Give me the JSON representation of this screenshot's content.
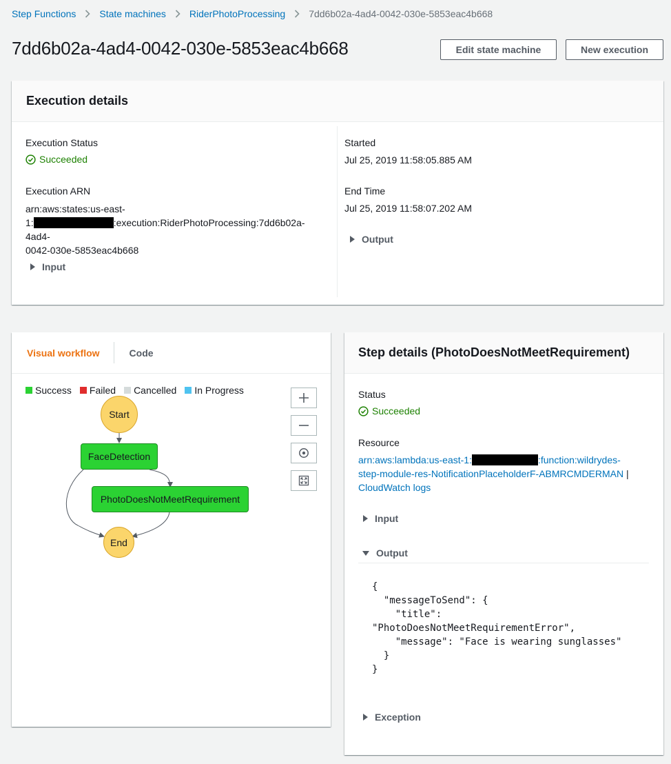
{
  "breadcrumb": {
    "items": [
      "Step Functions",
      "State machines",
      "RiderPhotoProcessing"
    ],
    "current": "7dd6b02a-4ad4-0042-030e-5853eac4b668"
  },
  "page": {
    "title": "7dd6b02a-4ad4-0042-030e-5853eac4b668",
    "edit_button": "Edit state machine",
    "new_button": "New execution"
  },
  "execution": {
    "header": "Execution details",
    "status_label": "Execution Status",
    "status_value": "Succeeded",
    "arn_label": "Execution ARN",
    "arn_line1": "arn:aws:states:us-east-",
    "arn_prefix2": "1:",
    "arn_suffix2": ":execution:RiderPhotoProcessing:7dd6b02a-4ad4-",
    "arn_line3": "0042-030e-5853eac4b668",
    "input_label": "Input",
    "started_label": "Started",
    "started_value": "Jul 25, 2019 11:58:05.885 AM",
    "end_label": "End Time",
    "end_value": "Jul 25, 2019 11:58:07.202 AM",
    "output_label": "Output"
  },
  "workflow": {
    "tabs": [
      "Visual workflow",
      "Code"
    ],
    "legend": [
      {
        "label": "Success",
        "color": "#2bd233"
      },
      {
        "label": "Failed",
        "color": "#e02d2d"
      },
      {
        "label": "Cancelled",
        "color": "#d5dbdb"
      },
      {
        "label": "In Progress",
        "color": "#4fc3f0"
      }
    ],
    "nodes": {
      "start": "Start",
      "face": "FaceDetection",
      "photo": "PhotoDoesNotMeetRequirement",
      "end": "End"
    },
    "controls": [
      "zoom-in-icon",
      "zoom-out-icon",
      "center-icon",
      "fit-screen-icon"
    ]
  },
  "step": {
    "header": "Step details (PhotoDoesNotMeetRequirement)",
    "status_label": "Status",
    "status_value": "Succeeded",
    "resource_label": "Resource",
    "resource_prefix": "arn:aws:lambda:us-east-1:",
    "resource_suffix": ":function:wildrydes-",
    "resource_line2": "step-module-res-NotificationPlaceholderF-ABMRCMDERMAN",
    "separator": "|",
    "logs_link": "CloudWatch logs",
    "input_label": "Input",
    "output_label": "Output",
    "output_json": "{\n  \"messageToSend\": {\n    \"title\":\n\"PhotoDoesNotMeetRequirementError\",\n    \"message\": \"Face is wearing sunglasses\"\n  }\n}",
    "exception_label": "Exception"
  },
  "colors": {
    "link": "#0073bb",
    "success": "#1d8102",
    "active_tab": "#ec7211"
  }
}
